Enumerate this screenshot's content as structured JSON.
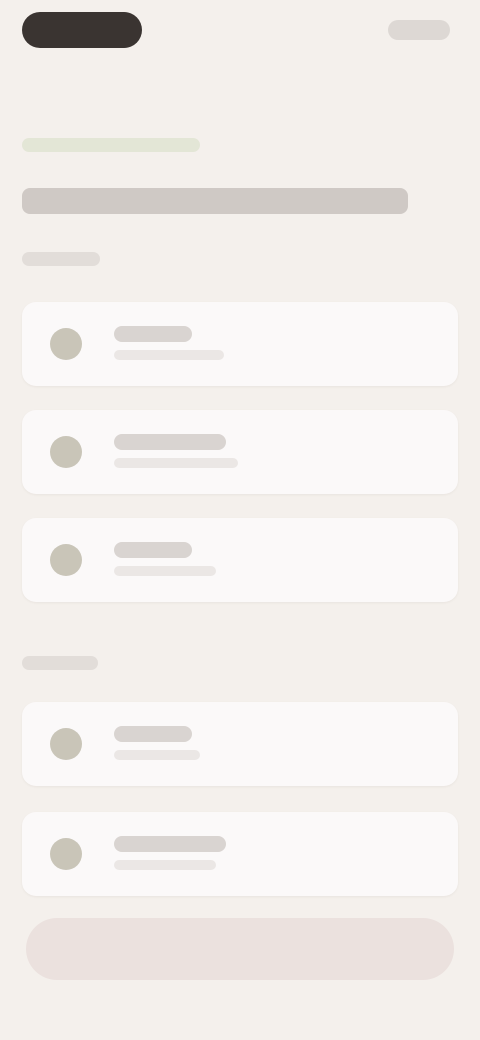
{
  "header": {
    "back_label": "",
    "top_right_label": "",
    "eyebrow": "",
    "title": ""
  },
  "sections": [
    {
      "caption": "",
      "items": [
        {
          "title": "",
          "subtitle": ""
        },
        {
          "title": "",
          "subtitle": ""
        },
        {
          "title": "",
          "subtitle": ""
        }
      ]
    },
    {
      "caption": "",
      "items": [
        {
          "title": "",
          "subtitle": ""
        },
        {
          "title": "",
          "subtitle": ""
        }
      ]
    }
  ],
  "footer": {
    "button_label": ""
  },
  "colors": {
    "background": "#f4f0ec",
    "card": "#fbf9f9",
    "pill": "#3a3431",
    "eyebrow_accent": "#e3e6d6",
    "avatar": "#c9c5b8",
    "primary_button": "#ebe1de"
  }
}
